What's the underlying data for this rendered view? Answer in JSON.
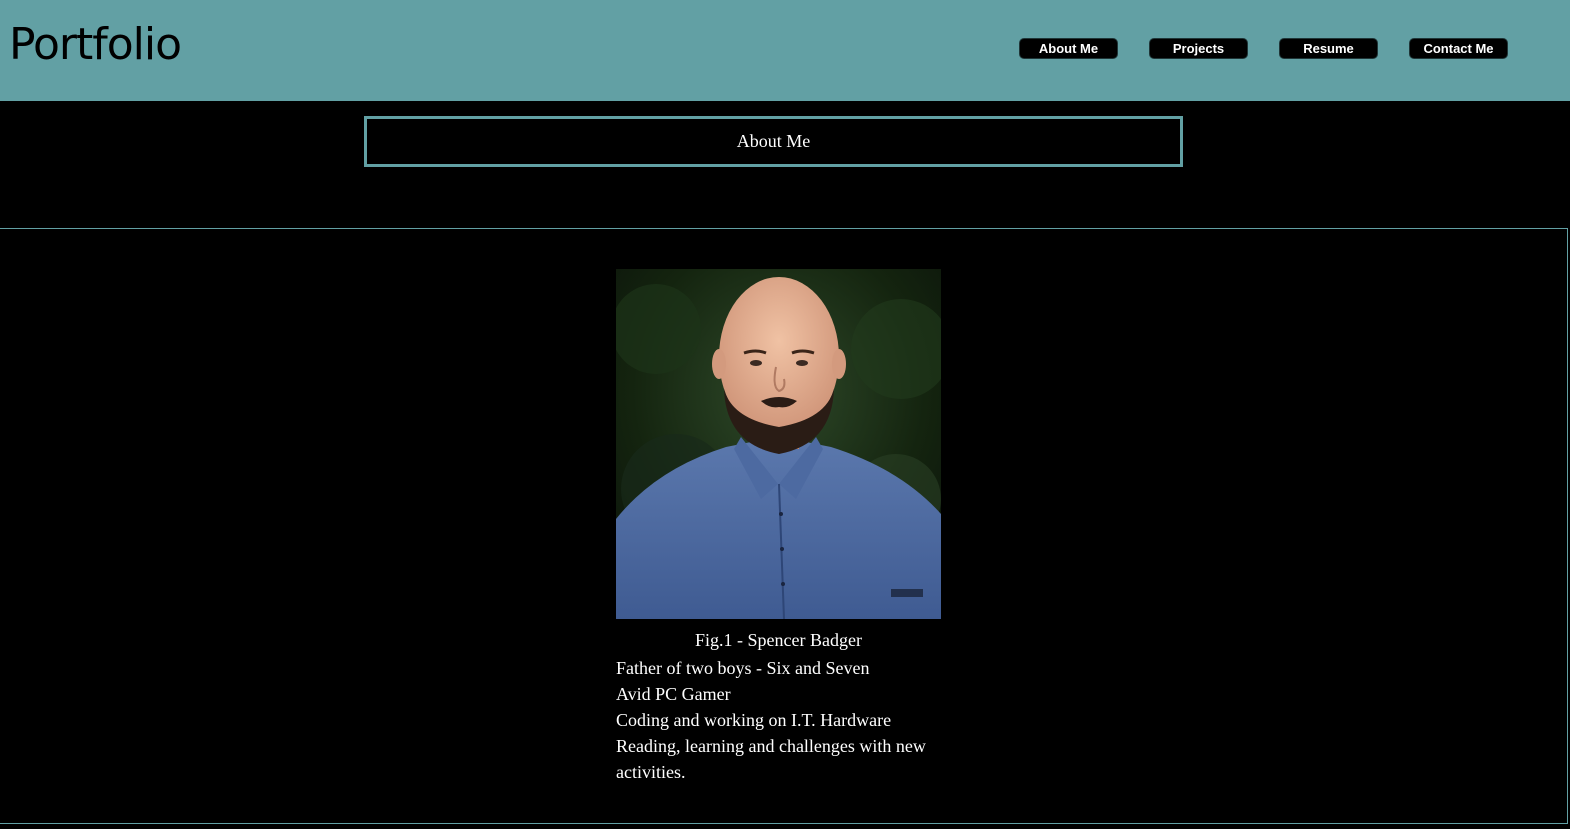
{
  "header": {
    "brand": "Portfolio",
    "nav": [
      {
        "label": "About Me"
      },
      {
        "label": "Projects"
      },
      {
        "label": "Resume"
      },
      {
        "label": "Contact Me"
      }
    ]
  },
  "section": {
    "title": "About Me"
  },
  "profile": {
    "caption": "Fig.1 - Spencer Badger",
    "items": [
      "Father of two boys - Six and Seven",
      "Avid PC Gamer",
      "Coding and working on I.T. Hardware",
      "Reading, learning and challenges with new activities."
    ]
  },
  "colors": {
    "accent": "#62a0a4",
    "background": "#000000",
    "text": "#ffffff"
  }
}
